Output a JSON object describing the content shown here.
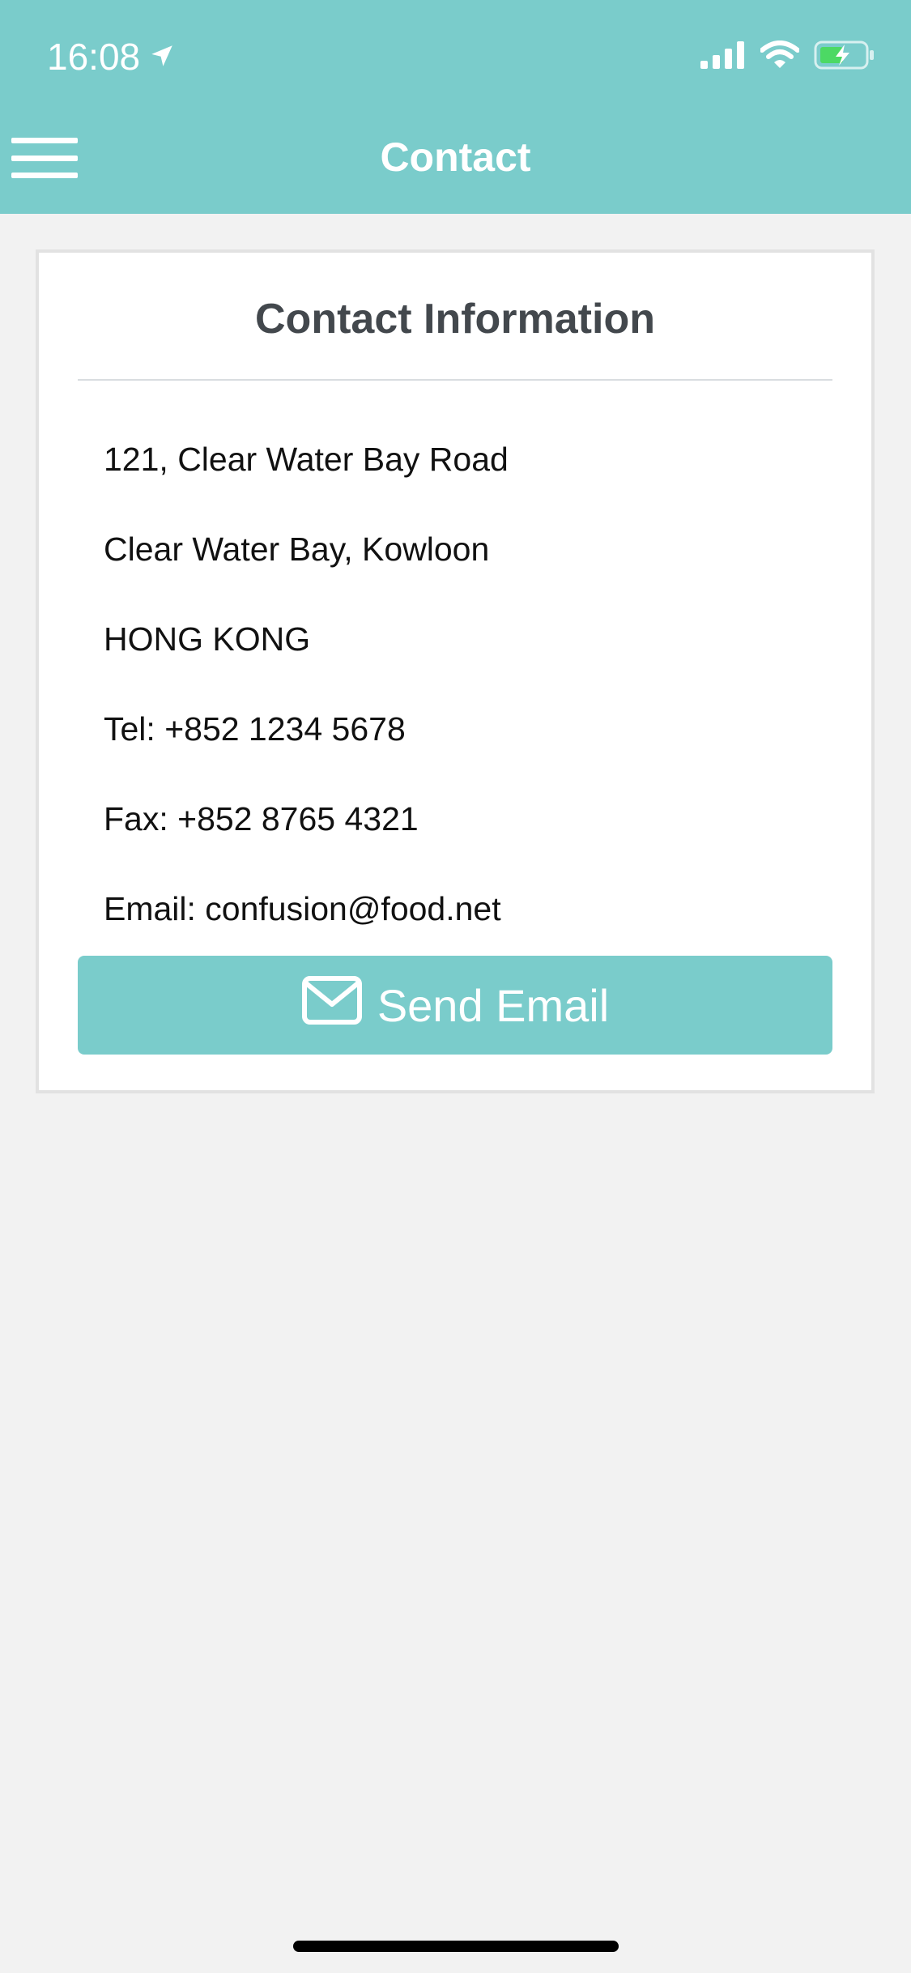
{
  "status_bar": {
    "time": "16:08",
    "icons": [
      "location-arrow-icon",
      "signal-icon",
      "wifi-icon",
      "battery-charging-icon"
    ]
  },
  "header": {
    "title": "Contact",
    "menu_icon": "hamburger-menu-icon"
  },
  "card": {
    "title": "Contact Information",
    "lines": [
      "121, Clear Water Bay Road",
      "Clear Water Bay, Kowloon",
      "HONG KONG",
      "Tel: +852 1234 5678",
      "Fax: +852 8765 4321",
      "Email: confusion@food.net"
    ],
    "button_label": "Send Email",
    "button_icon": "envelope-icon"
  },
  "colors": {
    "accent": "#7acccb",
    "background": "#f2f2f2",
    "title_text": "#43484d"
  }
}
